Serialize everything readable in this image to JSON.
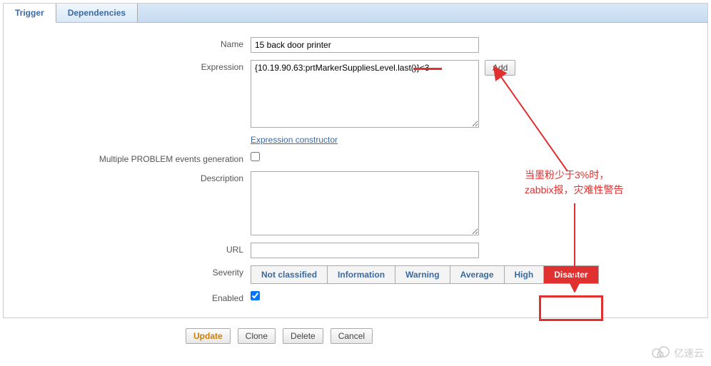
{
  "tabs": {
    "trigger": "Trigger",
    "dependencies": "Dependencies"
  },
  "labels": {
    "name": "Name",
    "expression": "Expression",
    "expr_constructor": "Expression constructor",
    "multiple_problem": "Multiple PROBLEM events generation",
    "description": "Description",
    "url": "URL",
    "severity": "Severity",
    "enabled": "Enabled"
  },
  "values": {
    "name": "15 back door printer",
    "expression": "{10.19.90.63:prtMarkerSuppliesLevel.last()}<3",
    "description": "",
    "url": "",
    "multiple_problem_checked": false,
    "enabled_checked": true
  },
  "buttons": {
    "add": "Add",
    "update": "Update",
    "clone": "Clone",
    "delete": "Delete",
    "cancel": "Cancel"
  },
  "severity": {
    "not_classified": "Not classified",
    "information": "Information",
    "warning": "Warning",
    "average": "Average",
    "high": "High",
    "disaster": "Disaster",
    "selected": "disaster"
  },
  "annotations": {
    "text1": "当墨粉少于3%时，",
    "text2": "zabbix报，灾难性警告"
  },
  "watermark": "亿速云"
}
